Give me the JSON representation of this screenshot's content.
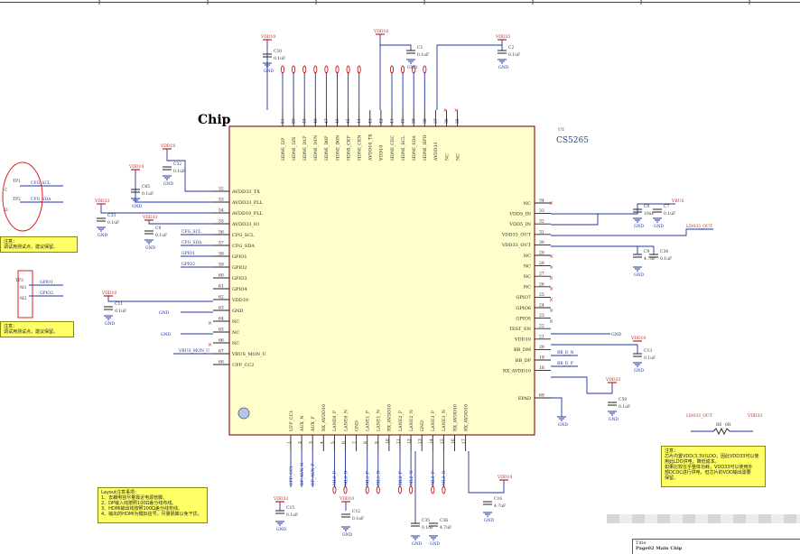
{
  "chip": {
    "heading": "Chip",
    "ref": "U1",
    "part": "CS5265",
    "left_pins": [
      {
        "num": "52",
        "name": "AVDD33_TX"
      },
      {
        "num": "53",
        "name": "AVDD33_PLL"
      },
      {
        "num": "54",
        "name": "AVDD10_PLL"
      },
      {
        "num": "55",
        "name": "AVDD33_IO"
      },
      {
        "num": "56",
        "name": "CFG_SCL"
      },
      {
        "num": "57",
        "name": "CFG_SDA"
      },
      {
        "num": "58",
        "name": "GPIO1"
      },
      {
        "num": "59",
        "name": "GPIO2"
      },
      {
        "num": "60",
        "name": "GPIO3"
      },
      {
        "num": "61",
        "name": "GPIO4"
      },
      {
        "num": "62",
        "name": "VDD10"
      },
      {
        "num": "63",
        "name": "GND"
      },
      {
        "num": "64",
        "name": "NC"
      },
      {
        "num": "65",
        "name": "NC"
      },
      {
        "num": "66",
        "name": "NC"
      },
      {
        "num": "67",
        "name": "VBUS_MON_U"
      },
      {
        "num": "68",
        "name": "UFP_CC2"
      }
    ],
    "right_pins": [
      {
        "num": "34",
        "name": "NC"
      },
      {
        "num": "33",
        "name": "VDD5_IN"
      },
      {
        "num": "32",
        "name": "VDD5_IN"
      },
      {
        "num": "31",
        "name": "VDD33_OUT"
      },
      {
        "num": "30",
        "name": "VDD33_OUT"
      },
      {
        "num": "29",
        "name": "NC"
      },
      {
        "num": "28",
        "name": "NC"
      },
      {
        "num": "27",
        "name": "NC"
      },
      {
        "num": "26",
        "name": "NC"
      },
      {
        "num": "25",
        "name": "GPIO7"
      },
      {
        "num": "24",
        "name": "GPIO6"
      },
      {
        "num": "23",
        "name": "GPIO5"
      },
      {
        "num": "22",
        "name": "TEST_EN"
      },
      {
        "num": "21",
        "name": "VDD10"
      },
      {
        "num": "20",
        "name": "BB_DM"
      },
      {
        "num": "19",
        "name": "BB_DP"
      },
      {
        "num": "18",
        "name": "RX_AVDD10"
      },
      {
        "num": "69",
        "name": "EPAD"
      }
    ],
    "top_pins": [
      {
        "num": "51",
        "name": "HDMI_I2P"
      },
      {
        "num": "50",
        "name": "HDMI_I2N"
      },
      {
        "num": "49",
        "name": "HDMI_D1P"
      },
      {
        "num": "48",
        "name": "HDMI_D1N"
      },
      {
        "num": "47",
        "name": "HDMI_D0P"
      },
      {
        "num": "46",
        "name": "HDMI_D0N"
      },
      {
        "num": "45",
        "name": "HDMI_CKP"
      },
      {
        "num": "44",
        "name": "HDMI_CKN"
      },
      {
        "num": "43",
        "name": "AVDD10_TX"
      },
      {
        "num": "42",
        "name": "VDD10"
      },
      {
        "num": "41",
        "name": "HDMI_CEC"
      },
      {
        "num": "40",
        "name": "HDMI_SCL"
      },
      {
        "num": "39",
        "name": "HDMI_SDA"
      },
      {
        "num": "38",
        "name": "HDMI_HPD"
      },
      {
        "num": "37",
        "name": "AVDD33"
      },
      {
        "num": "36",
        "name": "NC"
      },
      {
        "num": "35",
        "name": "NC"
      }
    ],
    "bottom_pins": [
      {
        "num": "1",
        "name": "UFP_CC1"
      },
      {
        "num": "2",
        "name": "AUX_N"
      },
      {
        "num": "3",
        "name": "AUX_P"
      },
      {
        "num": "4",
        "name": "RX_AVDD10"
      },
      {
        "num": "5",
        "name": "LANE0_P"
      },
      {
        "num": "6",
        "name": "LANE0_N"
      },
      {
        "num": "7",
        "name": "GND"
      },
      {
        "num": "8",
        "name": "LANE1_P"
      },
      {
        "num": "9",
        "name": "LANE1_N"
      },
      {
        "num": "10",
        "name": "RX_AVDD10"
      },
      {
        "num": "11",
        "name": "LANE2_P"
      },
      {
        "num": "12",
        "name": "LANE2_N"
      },
      {
        "num": "13",
        "name": "GND"
      },
      {
        "num": "14",
        "name": "LANE3_P"
      },
      {
        "num": "15",
        "name": "LANE3_N"
      },
      {
        "num": "16",
        "name": "RX_AVDD10"
      },
      {
        "num": "17",
        "name": "RX_AVDD10"
      }
    ],
    "bottom_nets": [
      "UFP_CC1",
      "DP_AUX_N",
      "DP_AUX_P",
      "",
      "ML0_P",
      "ML0_N",
      "",
      "ML1_P",
      "ML1_N",
      "",
      "ML2_P",
      "ML2_N",
      "",
      "ML3_P",
      "ML3_N",
      "",
      ""
    ]
  },
  "nets": {
    "left_cfg_scl": "CFG_SCL",
    "left_cfg_sda": "CFG_SDA",
    "left_gpio1": "GPIO1",
    "left_gpio2": "GPIO2",
    "vbus_mon": "VBUS_MON_U",
    "bb_dn": "BB_D_N",
    "bb_dp": "BB_D_P",
    "ldo_out": "LDO33_OUT",
    "ldo_out2": "LDO33_OUT",
    "vbus": "VBUS",
    "vdd33_r": "VDD33",
    "r_ref": "R6",
    "r_val": "0R",
    "gnd": "GND",
    "tp1": "TP1",
    "tp2": "TP2",
    "tp3": "TP3",
    "m1": "M1",
    "m2": "M2",
    "c_lbl": "C",
    "d_lbl": "D"
  },
  "power": {
    "vdd10": "VDD10",
    "vdd33": "VDD33"
  },
  "caps": [
    {
      "ref": "C10",
      "val": "0.1uF"
    },
    {
      "ref": "C1",
      "val": "0.1uF"
    },
    {
      "ref": "C2",
      "val": "0.1uF"
    },
    {
      "ref": "C32",
      "val": "0.1uF"
    },
    {
      "ref": "C65",
      "val": "0.1uF"
    },
    {
      "ref": "C33",
      "val": "0.1uF"
    },
    {
      "ref": "C8",
      "val": "0.1uF"
    },
    {
      "ref": "C11",
      "val": "0.1uF"
    },
    {
      "ref": "C6",
      "val": "10uF"
    },
    {
      "ref": "C7",
      "val": "0.1uF"
    },
    {
      "ref": "C9",
      "val": "4.7uF"
    },
    {
      "ref": "C34",
      "val": "0.1uF"
    },
    {
      "ref": "C13",
      "val": "0.1uF"
    },
    {
      "ref": "C59",
      "val": "0.1uF"
    },
    {
      "ref": "C15",
      "val": "0.1uF"
    },
    {
      "ref": "C12",
      "val": "0.1uF"
    },
    {
      "ref": "C16",
      "val": "4.7uF"
    },
    {
      "ref": "C35",
      "val": "0.1uF"
    },
    {
      "ref": "C36",
      "val": "4.7uF"
    }
  ],
  "notes": {
    "note1": [
      "注意：",
      "调试用测试点，建议保留。"
    ],
    "note2": [
      "注意：",
      "调试用测试点，建议保留。"
    ],
    "layout": [
      "Layout注意事项：",
      "1、去耦电容尽量靠近电源管脚。",
      "2、DP输入线按照100Ω差分线布线。",
      "3、HDMI输出线按照100Ω差分线布线。",
      "4、输出的HDMI为模拟信号，尽量隔离以免干扰。"
    ],
    "right": [
      "注意：",
      "芯片内置VDD(3.3V)LDO，因此VDD33可以使",
      "用此LDO供电，降低成本。",
      "如果比较在乎整体功耗，VDD33可以使用外",
      "部DCDC进行供电，但芯片的VDD输出需要",
      "保留。"
    ]
  },
  "titleblock": {
    "label": "Title",
    "value": "Page02 Main Chip"
  }
}
